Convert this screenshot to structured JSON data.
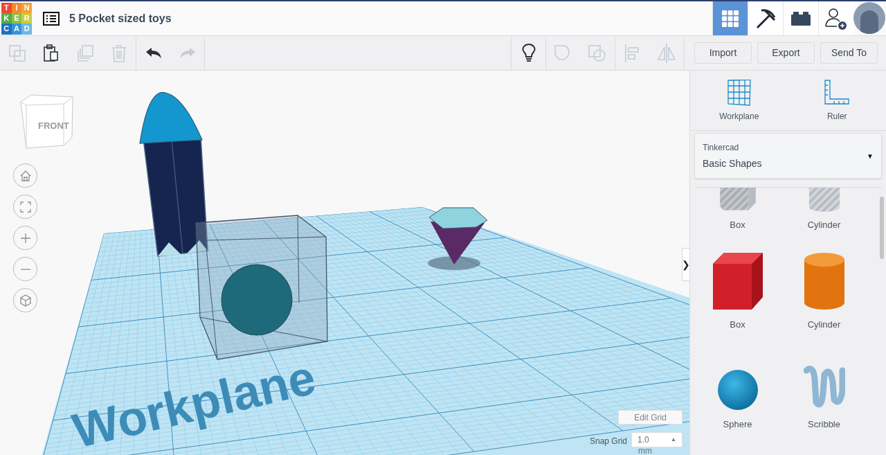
{
  "logo": {
    "letters": [
      "T",
      "I",
      "N",
      "K",
      "E",
      "R",
      "C",
      "A",
      "D"
    ]
  },
  "project_title": "5 Pocket sized toys",
  "header_tabs": [
    {
      "kind": "grid",
      "selected": true
    },
    {
      "kind": "pickaxe",
      "selected": false
    },
    {
      "kind": "brick",
      "selected": false
    },
    {
      "kind": "invite",
      "selected": false
    }
  ],
  "edit_tools": [
    {
      "kind": "copy",
      "disabled": true
    },
    {
      "kind": "paste",
      "disabled": false
    },
    {
      "kind": "duplicate",
      "disabled": true
    },
    {
      "kind": "delete",
      "disabled": true
    }
  ],
  "history_tools": [
    {
      "kind": "undo",
      "disabled": false
    },
    {
      "kind": "redo",
      "disabled": true
    }
  ],
  "shape_tools": [
    {
      "kind": "notes",
      "disabled": false
    },
    {
      "kind": "solid",
      "disabled": true
    },
    {
      "kind": "hole",
      "disabled": true
    },
    {
      "kind": "align",
      "disabled": true
    },
    {
      "kind": "mirror",
      "disabled": true
    }
  ],
  "actions": [
    "Import",
    "Export",
    "Send To"
  ],
  "view_cube": {
    "face": "FRONT"
  },
  "view_controls": [
    {
      "kind": "home"
    },
    {
      "kind": "fit"
    },
    {
      "kind": "zoom-in"
    },
    {
      "kind": "zoom-out"
    },
    {
      "kind": "perspective"
    }
  ],
  "workplane_label": "Workplane",
  "panel_toggle": "❯",
  "edit_grid": "Edit Grid",
  "snap_grid": {
    "label": "Snap Grid",
    "value": "1.0",
    "arrow": "▲",
    "unit": "mm"
  },
  "panel_tools": [
    {
      "kind": "workplane",
      "label": "Workplane"
    },
    {
      "kind": "ruler",
      "label": "Ruler"
    }
  ],
  "library": {
    "source": "Tinkercad",
    "category": "Basic Shapes",
    "arrow": "▼"
  },
  "shapes": [
    {
      "kind": "hole-box",
      "label": "Box"
    },
    {
      "kind": "hole-cylinder",
      "label": "Cylinder"
    },
    {
      "kind": "box",
      "label": "Box"
    },
    {
      "kind": "cylinder",
      "label": "Cylinder"
    },
    {
      "kind": "sphere",
      "label": "Sphere"
    },
    {
      "kind": "scribble",
      "label": "Scribble"
    }
  ]
}
